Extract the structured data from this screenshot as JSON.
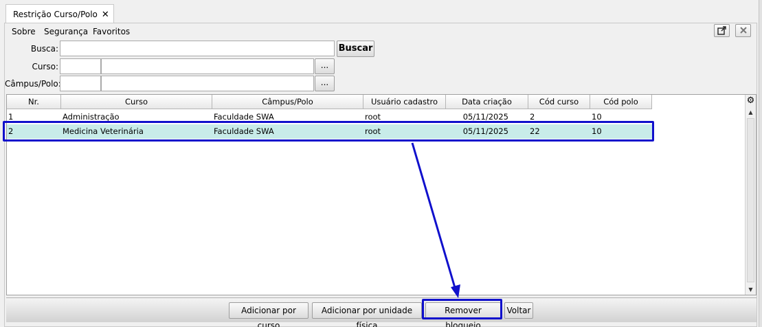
{
  "tab": {
    "title": "Restrição Curso/Polo",
    "close_glyph": "✕"
  },
  "menu": {
    "sobre": "Sobre",
    "seguranca": "Segurança",
    "favoritos": "Favoritos"
  },
  "window_buttons": {
    "popout_icon": "popout-icon",
    "close_icon": "close-icon"
  },
  "form": {
    "busca_label": "Busca:",
    "busca_value": "",
    "buscar_button": "Buscar",
    "curso_label": "Curso:",
    "curso_code": "",
    "curso_name": "",
    "campus_label": "Câmpus/Polo:",
    "campus_code": "",
    "campus_name": "",
    "lookup_button": "..."
  },
  "table": {
    "columns": [
      "Nr.",
      "Curso",
      "Câmpus/Polo",
      "Usuário cadastro",
      "Data criação",
      "Cód curso",
      "Cód polo"
    ],
    "rows": [
      {
        "nr": "1",
        "curso": "Administração",
        "campus": "Faculdade SWA",
        "usuario": "root",
        "data": "05/11/2025",
        "cod_curso": "2",
        "cod_polo": "10",
        "selected": false
      },
      {
        "nr": "2",
        "curso": "Medicina Veterinária",
        "campus": "Faculdade SWA",
        "usuario": "root",
        "data": "05/11/2025",
        "cod_curso": "22",
        "cod_polo": "10",
        "selected": true
      }
    ]
  },
  "actions": {
    "adicionar_curso": "Adicionar por curso",
    "adicionar_unidade": "Adicionar por unidade física",
    "remover_bloqueio": "Remover bloqueio",
    "voltar": "Voltar"
  },
  "colors": {
    "selection": "#c8ece9",
    "annotation": "#1010cc"
  }
}
